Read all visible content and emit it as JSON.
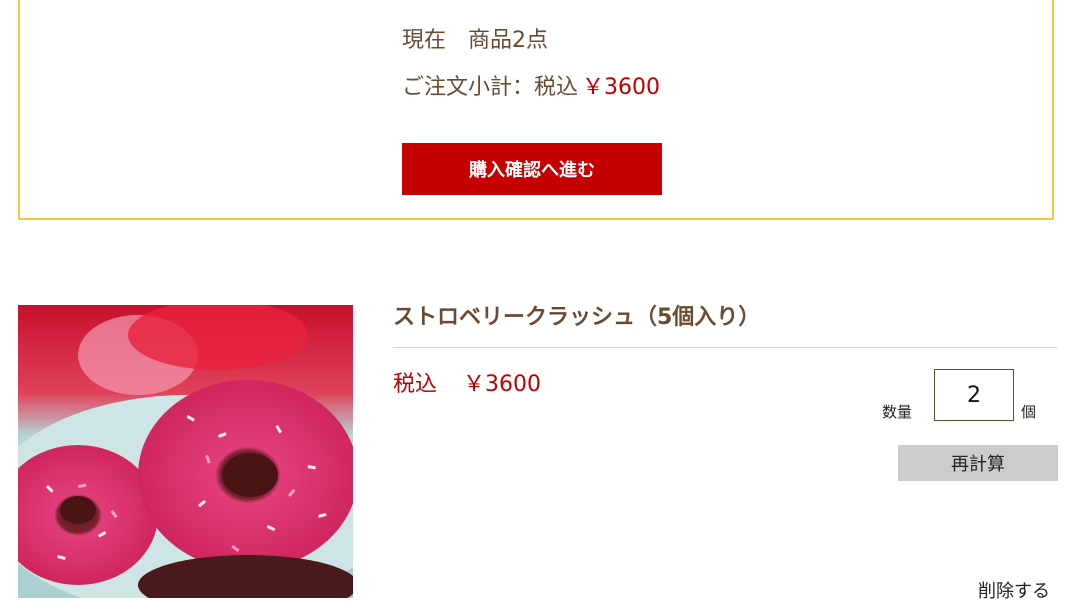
{
  "summary": {
    "current_label": "現在",
    "item_count": "商品2点",
    "subtotal_label": "ご注文小計：税込",
    "subtotal_price": "￥3600",
    "checkout_label": "購入確認へ進む"
  },
  "cart_item": {
    "name": "ストロベリークラッシュ（5個入り）",
    "tax_label": "税込",
    "price": "￥3600",
    "quantity_label": "数量",
    "quantity_value": "2",
    "quantity_unit": "個",
    "recalc_label": "再計算",
    "delete_label": "削除する"
  },
  "colors": {
    "accent_red": "#c40000",
    "border_yellow": "#f4c93a",
    "text_brown": "#6b4a33"
  }
}
